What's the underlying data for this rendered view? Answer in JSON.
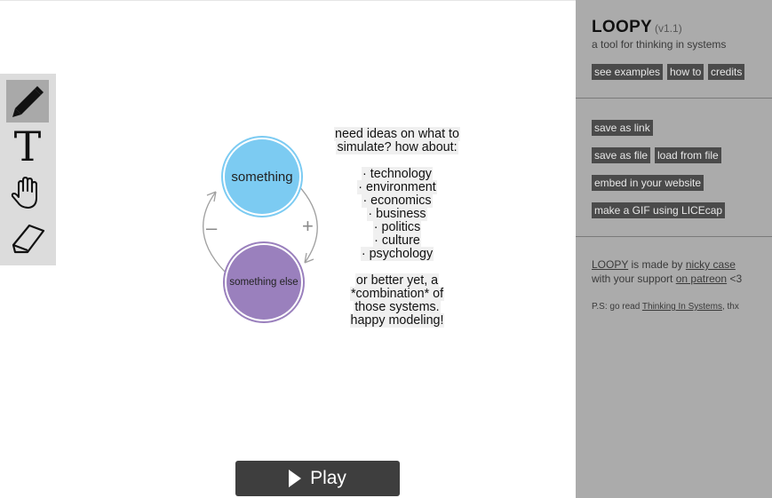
{
  "ideas": {
    "heading_line1": "need ideas on what to",
    "heading_line2": "simulate? how about:",
    "items": [
      "· technology",
      "· environment",
      "· economics",
      "· business",
      "· politics",
      "· culture",
      "· psychology"
    ],
    "closing": [
      "or better yet, a",
      "*combination* of",
      "those systems.",
      "happy modeling!"
    ]
  },
  "diagram": {
    "node1_label": "something",
    "node2_label": "something else",
    "plus_sign": "+",
    "minus_sign": "–",
    "node1_color": "#7ccbf2",
    "node2_color": "#9a80bd"
  },
  "toolbar": {
    "tools": [
      {
        "name": "pencil-icon",
        "active": true
      },
      {
        "name": "text-icon",
        "glyph": "T",
        "active": false
      },
      {
        "name": "hand-icon",
        "active": false
      },
      {
        "name": "eraser-icon",
        "active": false
      }
    ]
  },
  "play": {
    "label": "Play"
  },
  "sidebar": {
    "title": "LOOPY",
    "version": "(v1.1)",
    "subtitle": "a tool for thinking in systems",
    "see_examples": "see examples",
    "how_to": "how to",
    "credits": "credits",
    "save_as_link": "save as link",
    "save_as_file": "save as file",
    "load_from_file": "load from file",
    "embed": "embed in your website",
    "make_gif": "make a GIF using LICEcap",
    "credit_loopy": "LOOPY",
    "credit_made_by": " is made by ",
    "credit_author": "nicky case",
    "credit_with": "with your support ",
    "credit_patreon": "on patreon",
    "credit_heart": " <3",
    "ps_prefix": "P.S: go read ",
    "ps_book": "Thinking In Systems",
    "ps_suffix": ", thx"
  }
}
